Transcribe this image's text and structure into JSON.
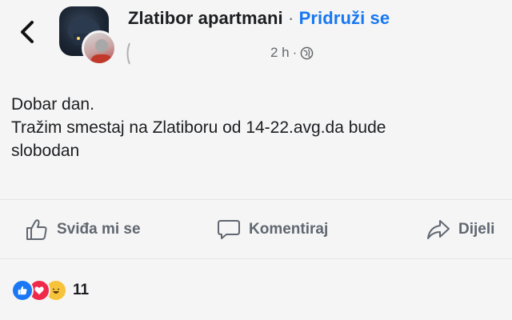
{
  "header": {
    "group_name": "Zlatibor apartmani",
    "separator": " · ",
    "join_label": "Pridruži se",
    "time": "2 h",
    "time_separator": "·",
    "privacy_icon": "globe-icon",
    "back_icon": "chevron-left-icon"
  },
  "post": {
    "lines": [
      "Dobar dan.",
      "Tražim smestaj na Zlatiboru od 14-22.avg.da bude",
      "slobodan"
    ]
  },
  "actions": {
    "like_label": "Sviđa mi se",
    "comment_label": "Komentiraj",
    "share_label": "Dijeli"
  },
  "reactions": {
    "icons": [
      "like-reaction-icon",
      "love-reaction-icon",
      "haha-reaction-icon"
    ],
    "count": "11"
  },
  "colors": {
    "link_blue": "#1877f2",
    "like_blue": "#1a78f4",
    "love_red": "#f02849",
    "haha_yellow": "#f7c33b",
    "muted_gray": "#65676b"
  }
}
